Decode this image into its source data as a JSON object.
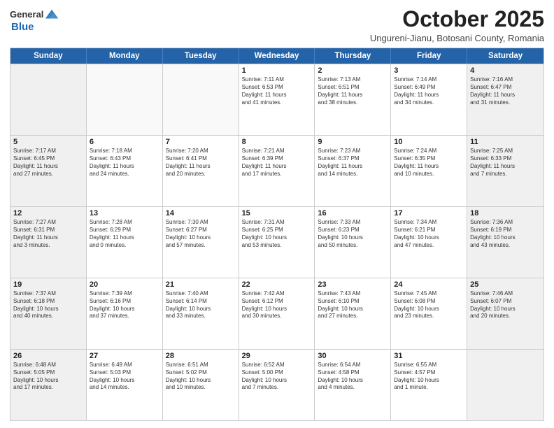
{
  "header": {
    "logo_line1": "General",
    "logo_line2": "Blue",
    "month": "October 2025",
    "location": "Ungureni-Jianu, Botosani County, Romania"
  },
  "days_of_week": [
    "Sunday",
    "Monday",
    "Tuesday",
    "Wednesday",
    "Thursday",
    "Friday",
    "Saturday"
  ],
  "weeks": [
    [
      {
        "day": "",
        "info": ""
      },
      {
        "day": "",
        "info": ""
      },
      {
        "day": "",
        "info": ""
      },
      {
        "day": "1",
        "info": "Sunrise: 7:11 AM\nSunset: 6:53 PM\nDaylight: 11 hours\nand 41 minutes."
      },
      {
        "day": "2",
        "info": "Sunrise: 7:13 AM\nSunset: 6:51 PM\nDaylight: 11 hours\nand 38 minutes."
      },
      {
        "day": "3",
        "info": "Sunrise: 7:14 AM\nSunset: 6:49 PM\nDaylight: 11 hours\nand 34 minutes."
      },
      {
        "day": "4",
        "info": "Sunrise: 7:16 AM\nSunset: 6:47 PM\nDaylight: 11 hours\nand 31 minutes."
      }
    ],
    [
      {
        "day": "5",
        "info": "Sunrise: 7:17 AM\nSunset: 6:45 PM\nDaylight: 11 hours\nand 27 minutes."
      },
      {
        "day": "6",
        "info": "Sunrise: 7:18 AM\nSunset: 6:43 PM\nDaylight: 11 hours\nand 24 minutes."
      },
      {
        "day": "7",
        "info": "Sunrise: 7:20 AM\nSunset: 6:41 PM\nDaylight: 11 hours\nand 20 minutes."
      },
      {
        "day": "8",
        "info": "Sunrise: 7:21 AM\nSunset: 6:39 PM\nDaylight: 11 hours\nand 17 minutes."
      },
      {
        "day": "9",
        "info": "Sunrise: 7:23 AM\nSunset: 6:37 PM\nDaylight: 11 hours\nand 14 minutes."
      },
      {
        "day": "10",
        "info": "Sunrise: 7:24 AM\nSunset: 6:35 PM\nDaylight: 11 hours\nand 10 minutes."
      },
      {
        "day": "11",
        "info": "Sunrise: 7:25 AM\nSunset: 6:33 PM\nDaylight: 11 hours\nand 7 minutes."
      }
    ],
    [
      {
        "day": "12",
        "info": "Sunrise: 7:27 AM\nSunset: 6:31 PM\nDaylight: 11 hours\nand 3 minutes."
      },
      {
        "day": "13",
        "info": "Sunrise: 7:28 AM\nSunset: 6:29 PM\nDaylight: 11 hours\nand 0 minutes."
      },
      {
        "day": "14",
        "info": "Sunrise: 7:30 AM\nSunset: 6:27 PM\nDaylight: 10 hours\nand 57 minutes."
      },
      {
        "day": "15",
        "info": "Sunrise: 7:31 AM\nSunset: 6:25 PM\nDaylight: 10 hours\nand 53 minutes."
      },
      {
        "day": "16",
        "info": "Sunrise: 7:33 AM\nSunset: 6:23 PM\nDaylight: 10 hours\nand 50 minutes."
      },
      {
        "day": "17",
        "info": "Sunrise: 7:34 AM\nSunset: 6:21 PM\nDaylight: 10 hours\nand 47 minutes."
      },
      {
        "day": "18",
        "info": "Sunrise: 7:36 AM\nSunset: 6:19 PM\nDaylight: 10 hours\nand 43 minutes."
      }
    ],
    [
      {
        "day": "19",
        "info": "Sunrise: 7:37 AM\nSunset: 6:18 PM\nDaylight: 10 hours\nand 40 minutes."
      },
      {
        "day": "20",
        "info": "Sunrise: 7:39 AM\nSunset: 6:16 PM\nDaylight: 10 hours\nand 37 minutes."
      },
      {
        "day": "21",
        "info": "Sunrise: 7:40 AM\nSunset: 6:14 PM\nDaylight: 10 hours\nand 33 minutes."
      },
      {
        "day": "22",
        "info": "Sunrise: 7:42 AM\nSunset: 6:12 PM\nDaylight: 10 hours\nand 30 minutes."
      },
      {
        "day": "23",
        "info": "Sunrise: 7:43 AM\nSunset: 6:10 PM\nDaylight: 10 hours\nand 27 minutes."
      },
      {
        "day": "24",
        "info": "Sunrise: 7:45 AM\nSunset: 6:08 PM\nDaylight: 10 hours\nand 23 minutes."
      },
      {
        "day": "25",
        "info": "Sunrise: 7:46 AM\nSunset: 6:07 PM\nDaylight: 10 hours\nand 20 minutes."
      }
    ],
    [
      {
        "day": "26",
        "info": "Sunrise: 6:48 AM\nSunset: 5:05 PM\nDaylight: 10 hours\nand 17 minutes."
      },
      {
        "day": "27",
        "info": "Sunrise: 6:49 AM\nSunset: 5:03 PM\nDaylight: 10 hours\nand 14 minutes."
      },
      {
        "day": "28",
        "info": "Sunrise: 6:51 AM\nSunset: 5:02 PM\nDaylight: 10 hours\nand 10 minutes."
      },
      {
        "day": "29",
        "info": "Sunrise: 6:52 AM\nSunset: 5:00 PM\nDaylight: 10 hours\nand 7 minutes."
      },
      {
        "day": "30",
        "info": "Sunrise: 6:54 AM\nSunset: 4:58 PM\nDaylight: 10 hours\nand 4 minutes."
      },
      {
        "day": "31",
        "info": "Sunrise: 6:55 AM\nSunset: 4:57 PM\nDaylight: 10 hours\nand 1 minute."
      },
      {
        "day": "",
        "info": ""
      }
    ]
  ]
}
